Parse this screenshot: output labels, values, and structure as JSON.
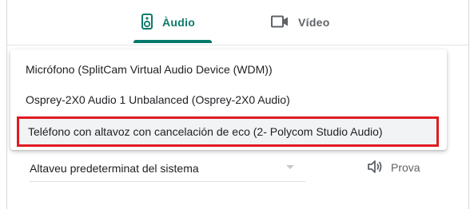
{
  "tabs": [
    {
      "label": "Àudio",
      "icon": "speaker-device-icon",
      "selected": true
    },
    {
      "label": "Vídeo",
      "icon": "video-camera-icon",
      "selected": false
    }
  ],
  "colors": {
    "accent": "#00796b",
    "highlight_border": "#e01b22"
  },
  "microphone_menu": {
    "options": [
      "Micrófono (SplitCam Virtual Audio Device (WDM))",
      "Osprey-2X0 Audio 1 Unbalanced (Osprey-2X0 Audio)",
      "Teléfono con altavoz con cancelación de eco (2- Polycom Studio Audio)"
    ],
    "highlighted_index": 2
  },
  "speaker": {
    "value": "Altaveu predeterminat del sistema",
    "test_label": "Prova",
    "test_icon": "volume-icon"
  }
}
